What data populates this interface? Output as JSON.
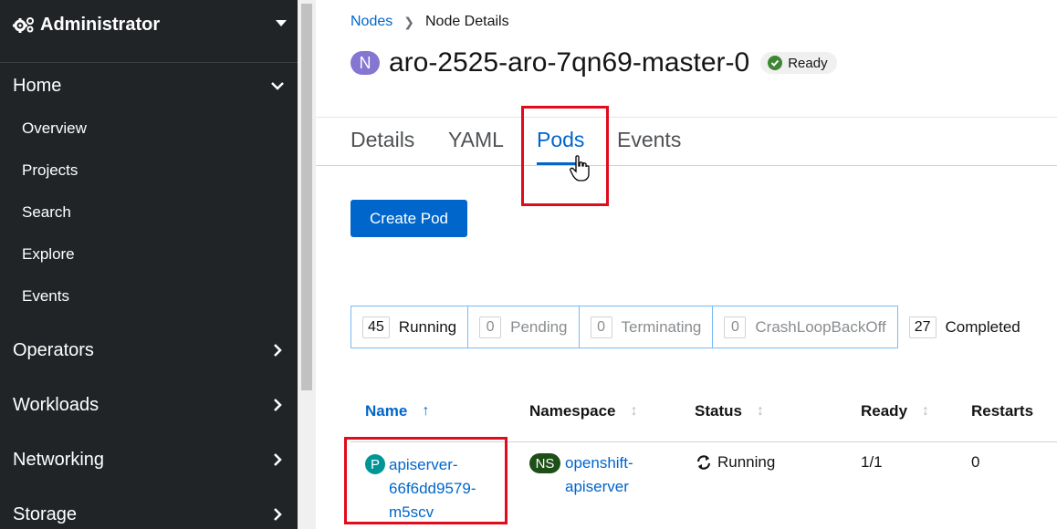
{
  "sidebar": {
    "perspective": "Administrator",
    "sections": [
      {
        "label": "Home",
        "expanded": true,
        "items": [
          "Overview",
          "Projects",
          "Search",
          "Explore",
          "Events"
        ]
      },
      {
        "label": "Operators",
        "expanded": false
      },
      {
        "label": "Workloads",
        "expanded": false
      },
      {
        "label": "Networking",
        "expanded": false
      },
      {
        "label": "Storage",
        "expanded": false
      }
    ]
  },
  "breadcrumb": {
    "parent": "Nodes",
    "current": "Node Details"
  },
  "header": {
    "badge": "N",
    "title": "aro-2525-aro-7qn69-master-0",
    "status": "Ready"
  },
  "tabs": [
    {
      "label": "Details"
    },
    {
      "label": "YAML"
    },
    {
      "label": "Pods",
      "active": true
    },
    {
      "label": "Events"
    }
  ],
  "create_button": "Create Pod",
  "filters": [
    {
      "count": "45",
      "label": "Running",
      "active": true
    },
    {
      "count": "0",
      "label": "Pending"
    },
    {
      "count": "0",
      "label": "Terminating"
    },
    {
      "count": "0",
      "label": "CrashLoopBackOff"
    },
    {
      "count": "27",
      "label": "Completed",
      "active": true
    }
  ],
  "table": {
    "columns": [
      "Name",
      "Namespace",
      "Status",
      "Ready",
      "Restarts"
    ],
    "rows": [
      {
        "kind_badge": "P",
        "name_lines": [
          "apiserver-",
          "66f6dd9579-",
          "m5scv"
        ],
        "ns_badge": "NS",
        "namespace_lines": [
          "openshift-",
          "apiserver"
        ],
        "status": "Running",
        "ready": "1/1",
        "restarts": "0"
      }
    ]
  },
  "colors": {
    "link": "#0066cc",
    "sidebar_bg": "#212427",
    "highlight": "#e00b1c",
    "ready_green": "#3e8635"
  }
}
